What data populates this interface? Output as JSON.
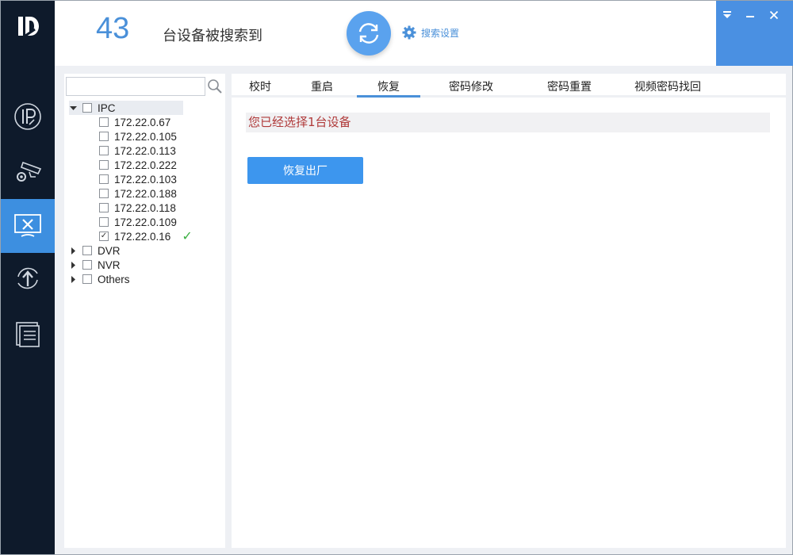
{
  "header": {
    "count": "43",
    "found_text": "台设备被搜索到",
    "search_settings_label": "搜索设置"
  },
  "nav": {
    "items": [
      {
        "icon": "ip-icon"
      },
      {
        "icon": "camera-settings-icon"
      },
      {
        "icon": "tools-icon",
        "active": true
      },
      {
        "icon": "upgrade-icon"
      },
      {
        "icon": "document-icon"
      }
    ]
  },
  "search": {
    "value": "",
    "placeholder": ""
  },
  "tree": {
    "groups": [
      {
        "label": "IPC",
        "expanded": true,
        "devices": [
          {
            "ip": "172.22.0.67",
            "checked": false
          },
          {
            "ip": "172.22.0.105",
            "checked": false
          },
          {
            "ip": "172.22.0.113",
            "checked": false
          },
          {
            "ip": "172.22.0.222",
            "checked": false
          },
          {
            "ip": "172.22.0.103",
            "checked": false
          },
          {
            "ip": "172.22.0.188",
            "checked": false
          },
          {
            "ip": "172.22.0.118",
            "checked": false
          },
          {
            "ip": "172.22.0.109",
            "checked": false
          },
          {
            "ip": "172.22.0.16",
            "checked": true,
            "status": "✓"
          }
        ]
      },
      {
        "label": "DVR",
        "expanded": false
      },
      {
        "label": "NVR",
        "expanded": false
      },
      {
        "label": "Others",
        "expanded": false
      }
    ]
  },
  "tabs": [
    {
      "label": "校时"
    },
    {
      "label": "重启"
    },
    {
      "label": "恢复",
      "active": true
    },
    {
      "label": "密码修改"
    },
    {
      "label": "密码重置"
    },
    {
      "label": "视频密码找回"
    }
  ],
  "main": {
    "selected_message": "您已经选择1台设备",
    "restore_button": "恢复出厂"
  },
  "colors": {
    "accent": "#4a90d9",
    "nav_bg": "#0e1a2b",
    "message_red": "#b03a3a",
    "ok_green": "#3cb043"
  }
}
